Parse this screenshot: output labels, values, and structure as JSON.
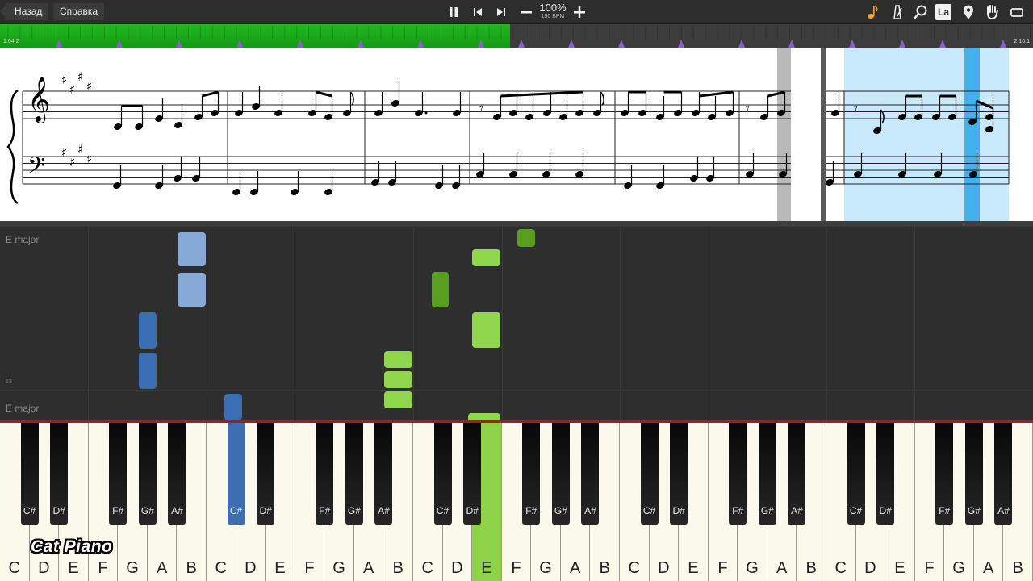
{
  "toolbar": {
    "back_label": "Назад",
    "help_label": "Справка",
    "speed_percent": "100%",
    "speed_bpm": "190 BPM",
    "label_icon_text": "La"
  },
  "timeline": {
    "current_time": "1:04.2",
    "total_time": "2:10.1",
    "progress": 0.494
  },
  "notes_area": {
    "key_label_top": "E major",
    "key_label_bottom": "E major",
    "measure_number": "53"
  },
  "keyboard": {
    "white_keys": [
      "C",
      "D",
      "E",
      "F",
      "G",
      "A",
      "B",
      "C",
      "D",
      "E",
      "F",
      "G",
      "A",
      "B",
      "C",
      "D",
      "E",
      "F",
      "G",
      "A",
      "B",
      "C",
      "D",
      "E",
      "F",
      "G",
      "A",
      "B",
      "C",
      "D",
      "E",
      "F",
      "G",
      "A",
      "B"
    ],
    "black_keys": [
      "C#",
      "D#",
      "F#",
      "G#",
      "A#",
      "C#",
      "D#",
      "F#",
      "G#",
      "A#",
      "C#",
      "D#",
      "F#",
      "G#",
      "A#",
      "C#",
      "D#",
      "F#",
      "G#",
      "A#",
      "C#",
      "D#",
      "F#",
      "G#",
      "A#"
    ],
    "active_white_index": 16,
    "active_black_index": 5
  },
  "colors": {
    "played": "#1cb01c",
    "left_hand": "#3b6db3",
    "left_hand_light": "#86a9d6",
    "right_hand": "#8fd64c",
    "right_hand_dark": "#5a9e1f",
    "highlight": "#c8e8fb"
  },
  "watermark": "Cat Piano"
}
